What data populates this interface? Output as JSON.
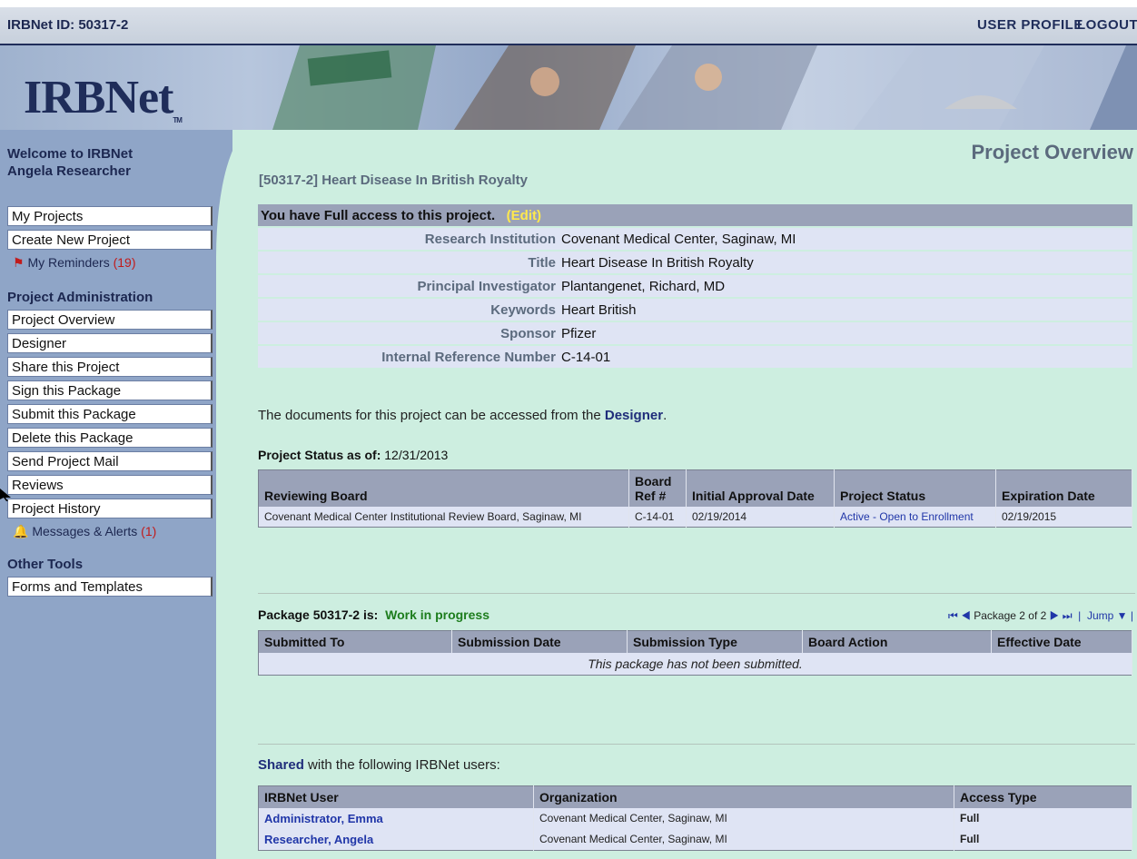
{
  "topbar": {
    "id_label": "IRBNet ID: 50317-2",
    "user_profile": "USER PROFILE",
    "logout": "LOGOUT"
  },
  "logo": {
    "text": "IRBNet",
    "tm": "TM"
  },
  "sidebar": {
    "welcome_line1": "Welcome to IRBNet",
    "welcome_line2": "Angela Researcher",
    "main_links": [
      "My Projects",
      "Create New Project"
    ],
    "reminders": {
      "label": "My Reminders",
      "count": "(19)"
    },
    "admin_heading": "Project Administration",
    "admin_links": [
      "Project Overview",
      "Designer",
      "Share this Project",
      "Sign this Package",
      "Submit this Package",
      "Delete this Package",
      "Send Project Mail",
      "Reviews",
      "Project History"
    ],
    "messages": {
      "label": "Messages & Alerts",
      "count": "(1)"
    },
    "tools_heading": "Other Tools",
    "tools_links": [
      "Forms and Templates"
    ]
  },
  "main": {
    "page_title": "Project Overview",
    "project_heading": "[50317-2] Heart Disease In British Royalty",
    "access": {
      "text": "You have Full access to this project.",
      "edit": "(Edit)"
    },
    "info_rows": [
      {
        "label": "Research Institution",
        "value": "Covenant Medical Center, Saginaw, MI"
      },
      {
        "label": "Title",
        "value": "Heart Disease In British Royalty"
      },
      {
        "label": "Principal Investigator",
        "value": "Plantangenet, Richard, MD"
      },
      {
        "label": "Keywords",
        "value": "Heart British"
      },
      {
        "label": "Sponsor",
        "value": "Pfizer"
      },
      {
        "label": "Internal Reference Number",
        "value": "C-14-01"
      }
    ],
    "documents_text_pre": "The documents for this project can be accessed from the",
    "documents_link": "Designer",
    "documents_text_post": ".",
    "status_label": "Project Status as of:",
    "status_date": "12/31/2013",
    "status_table": {
      "headers": [
        "Reviewing Board",
        "Board Ref #",
        "Initial Approval Date",
        "Project Status",
        "Expiration Date"
      ],
      "row": {
        "board": "Covenant Medical Center Institutional Review Board, Saginaw, MI",
        "ref": "C-14-01",
        "approval": "02/19/2014",
        "status": "Active - Open to Enrollment",
        "expiration": "02/19/2015"
      }
    },
    "package": {
      "label": "Package 50317-2 is:",
      "state": "Work in progress",
      "pager_text": "Package 2 of 2",
      "jump": "Jump"
    },
    "package_table": {
      "headers": [
        "Submitted To",
        "Submission Date",
        "Submission Type",
        "Board Action",
        "Effective Date"
      ],
      "empty": "This package has not been submitted."
    },
    "shared": {
      "link": "Shared",
      "text": "with the following IRBNet users:",
      "headers": [
        "IRBNet User",
        "Organization",
        "Access Type"
      ],
      "rows": [
        {
          "user": "Administrator, Emma",
          "org": "Covenant Medical Center, Saginaw, MI",
          "access": "Full"
        },
        {
          "user": "Researcher, Angela",
          "org": "Covenant Medical Center, Saginaw, MI",
          "access": "Full"
        }
      ]
    }
  }
}
